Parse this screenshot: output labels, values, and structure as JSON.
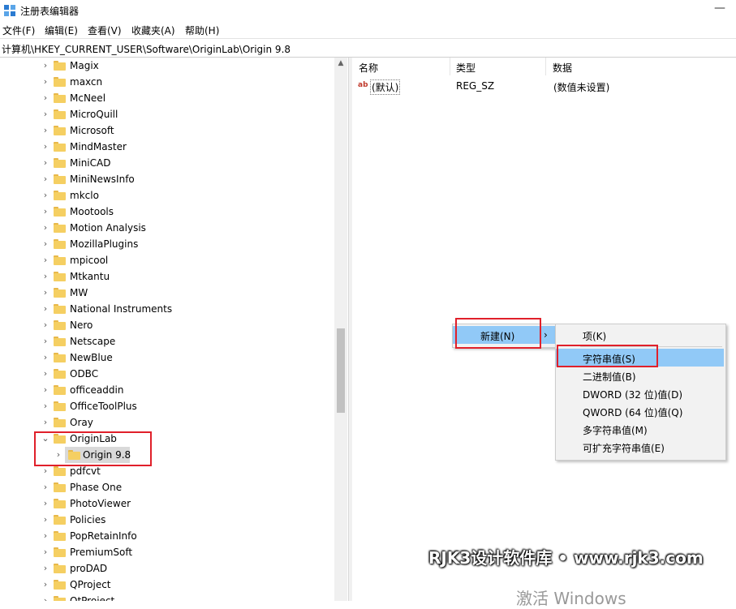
{
  "window": {
    "title": "注册表编辑器",
    "minimize_glyph": "—"
  },
  "menu": [
    "文件(F)",
    "编辑(E)",
    "查看(V)",
    "收藏夹(A)",
    "帮助(H)"
  ],
  "address": "计算机\\HKEY_CURRENT_USER\\Software\\OriginLab\\Origin 9.8",
  "tree": {
    "items": [
      {
        "label": "Magix",
        "expanded": false
      },
      {
        "label": "maxcn",
        "expanded": false
      },
      {
        "label": "McNeel",
        "expanded": false
      },
      {
        "label": "MicroQuill",
        "expanded": false
      },
      {
        "label": "Microsoft",
        "expanded": false
      },
      {
        "label": "MindMaster",
        "expanded": false
      },
      {
        "label": "MiniCAD",
        "expanded": false
      },
      {
        "label": "MiniNewsInfo",
        "expanded": false
      },
      {
        "label": "mkclo",
        "expanded": false
      },
      {
        "label": "Mootools",
        "expanded": false
      },
      {
        "label": "Motion Analysis",
        "expanded": false
      },
      {
        "label": "MozillaPlugins",
        "expanded": false
      },
      {
        "label": "mpicool",
        "expanded": false
      },
      {
        "label": "Mtkantu",
        "expanded": false
      },
      {
        "label": "MW",
        "expanded": false
      },
      {
        "label": "National Instruments",
        "expanded": false
      },
      {
        "label": "Nero",
        "expanded": false
      },
      {
        "label": "Netscape",
        "expanded": false
      },
      {
        "label": "NewBlue",
        "expanded": false
      },
      {
        "label": "ODBC",
        "expanded": false
      },
      {
        "label": "officeaddin",
        "expanded": false
      },
      {
        "label": "OfficeToolPlus",
        "expanded": false
      },
      {
        "label": "Oray",
        "expanded": false
      },
      {
        "label": "OriginLab",
        "expanded": true
      },
      {
        "label": "Origin 9.8",
        "expanded": false,
        "child": true,
        "selected": true
      },
      {
        "label": "pdfcvt",
        "expanded": false
      },
      {
        "label": "Phase One",
        "expanded": false
      },
      {
        "label": "PhotoViewer",
        "expanded": false
      },
      {
        "label": "Policies",
        "expanded": false
      },
      {
        "label": "PopRetainInfo",
        "expanded": false
      },
      {
        "label": "PremiumSoft",
        "expanded": false
      },
      {
        "label": "proDAD",
        "expanded": false
      },
      {
        "label": "QProject",
        "expanded": false
      },
      {
        "label": "QtProject",
        "expanded": false
      }
    ]
  },
  "list": {
    "columns": [
      "名称",
      "类型",
      "数据"
    ],
    "rows": [
      {
        "icon": "ab",
        "name": "(默认)",
        "type": "REG_SZ",
        "data": "(数值未设置)"
      }
    ]
  },
  "context_menu": {
    "item": "新建(N)",
    "arrow": "›"
  },
  "submenu": {
    "items": [
      "项(K)",
      "字符串值(S)",
      "二进制值(B)",
      "DWORD (32 位)值(D)",
      "QWORD (64 位)值(Q)",
      "多字符串值(M)",
      "可扩充字符串值(E)"
    ],
    "highlighted_index": 1
  },
  "overlay": {
    "watermark": "RJK3设计软件库 • www.rjk3.com",
    "activate_windows": "激活 Windows"
  },
  "colors": {
    "highlight": "#91c9f7",
    "annotation_red": "#e0202a",
    "folder": "#f5cf62"
  }
}
